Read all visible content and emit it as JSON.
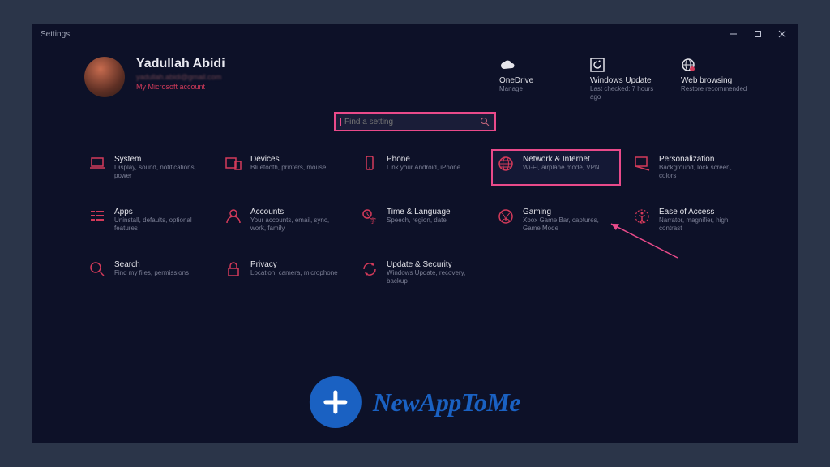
{
  "window": {
    "title": "Settings"
  },
  "user": {
    "name": "Yadullah Abidi",
    "email_blurred": "yadullah.abidi@gmail.com",
    "account_link": "My Microsoft account"
  },
  "status": {
    "onedrive": {
      "title": "OneDrive",
      "sub": "Manage"
    },
    "update": {
      "title": "Windows Update",
      "sub": "Last checked: 7 hours ago"
    },
    "web": {
      "title": "Web browsing",
      "sub": "Restore recommended"
    }
  },
  "search": {
    "placeholder": "Find a setting"
  },
  "tiles": {
    "system": {
      "title": "System",
      "sub": "Display, sound, notifications, power"
    },
    "devices": {
      "title": "Devices",
      "sub": "Bluetooth, printers, mouse"
    },
    "phone": {
      "title": "Phone",
      "sub": "Link your Android, iPhone"
    },
    "network": {
      "title": "Network & Internet",
      "sub": "Wi-Fi, airplane mode, VPN"
    },
    "personalization": {
      "title": "Personalization",
      "sub": "Background, lock screen, colors"
    },
    "apps": {
      "title": "Apps",
      "sub": "Uninstall, defaults, optional features"
    },
    "accounts": {
      "title": "Accounts",
      "sub": "Your accounts, email, sync, work, family"
    },
    "time": {
      "title": "Time & Language",
      "sub": "Speech, region, date"
    },
    "gaming": {
      "title": "Gaming",
      "sub": "Xbox Game Bar, captures, Game Mode"
    },
    "ease": {
      "title": "Ease of Access",
      "sub": "Narrator, magnifier, high contrast"
    },
    "search_cat": {
      "title": "Search",
      "sub": "Find my files, permissions"
    },
    "privacy": {
      "title": "Privacy",
      "sub": "Location, camera, microphone"
    },
    "update_sec": {
      "title": "Update & Security",
      "sub": "Windows Update, recovery, backup"
    }
  },
  "watermark": {
    "text": "NewAppToMe"
  },
  "colors": {
    "accent": "#d43a5a",
    "highlight": "#e94a8a",
    "brand": "#1a61c2"
  }
}
